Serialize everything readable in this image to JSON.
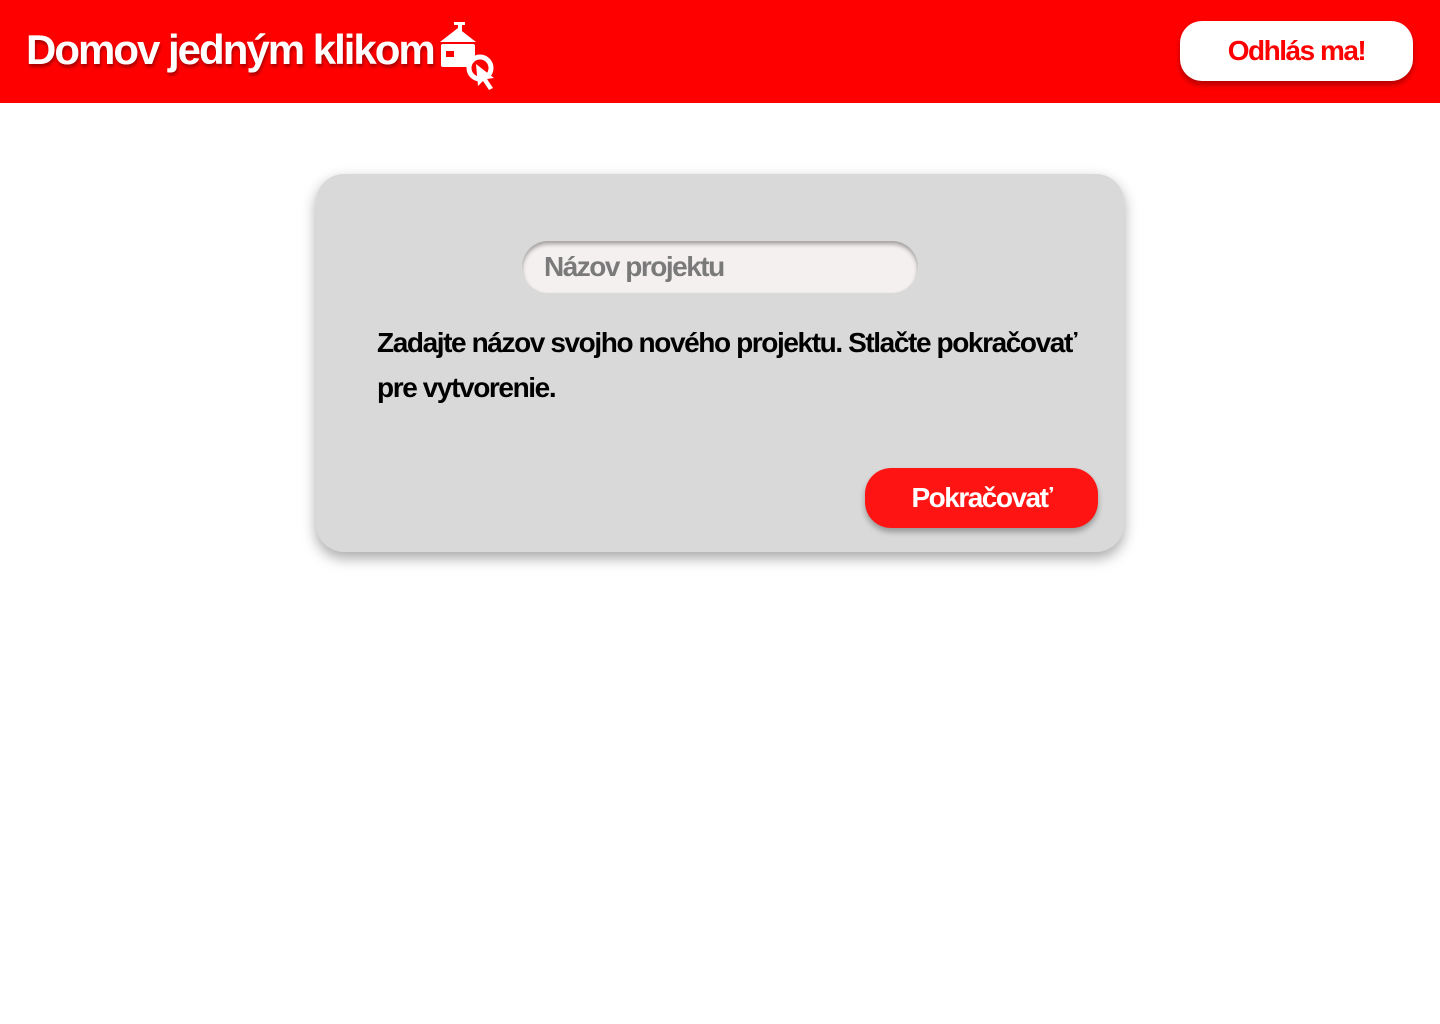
{
  "header": {
    "title": "Domov jedným klikom",
    "logo_icon": "house-with-cursor-icon",
    "logout_label": "Odhlás ma!"
  },
  "new_project_dialog": {
    "name_input": {
      "placeholder": "Názov projektu",
      "value": ""
    },
    "instructions": "Zadajte názov svojho nového projektu. Stlačte pokračovať pre vytvorenie.",
    "continue_label": "Pokračovať"
  },
  "colors": {
    "brand": "#ff0000",
    "card_background": "#d9d9d9",
    "input_background": "#f5f0f0",
    "button_red": "#ff1414"
  }
}
